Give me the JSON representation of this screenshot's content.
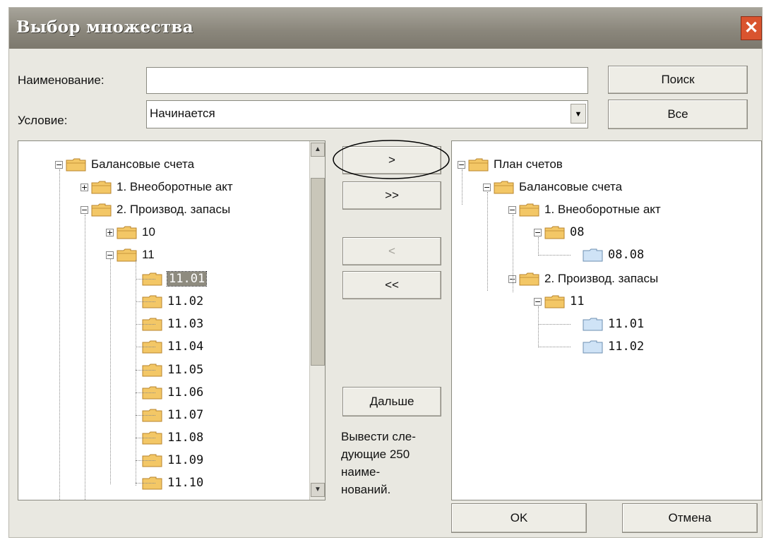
{
  "window": {
    "title": "Выбор множества",
    "close_glyph": "✕"
  },
  "form": {
    "name_label": "Наименование:",
    "name_value": "",
    "condition_label": "Условие:",
    "condition_value": "Начинается",
    "search_button": "Поиск",
    "all_button": "Все"
  },
  "transfer": {
    "add_one": ">",
    "add_all": ">>",
    "remove_one": "<",
    "remove_all": "<<",
    "next_button": "Дальше",
    "next_note": [
      "Вывести сле-",
      "дующие 250",
      "наиме-",
      "нований."
    ]
  },
  "left_tree": [
    {
      "label": "Балансовые счета",
      "pm": "−"
    },
    {
      "label": "1. Внеоборотные акт",
      "pm": "+"
    },
    {
      "label": "2. Производ. запасы",
      "pm": "−"
    },
    {
      "label": "10",
      "pm": "+"
    },
    {
      "label": "11",
      "pm": "−"
    },
    {
      "label": "11.01",
      "selected": true
    },
    {
      "label": "11.02"
    },
    {
      "label": "11.03"
    },
    {
      "label": "11.04"
    },
    {
      "label": "11.05"
    },
    {
      "label": "11.06"
    },
    {
      "label": "11.07"
    },
    {
      "label": "11.08"
    },
    {
      "label": "11.09"
    },
    {
      "label": "11.10"
    }
  ],
  "right_tree": [
    {
      "label": "План счетов",
      "pm": "−"
    },
    {
      "label": "Балансовые счета",
      "pm": "−"
    },
    {
      "label": "1. Внеоборотные акт",
      "pm": "−"
    },
    {
      "label": "08",
      "pm": "−"
    },
    {
      "label": "08.08"
    },
    {
      "label": "2. Производ. запасы",
      "pm": "−"
    },
    {
      "label": "11",
      "pm": "−"
    },
    {
      "label": "11.01"
    },
    {
      "label": "11.02"
    }
  ],
  "footer": {
    "ok_button": "OK",
    "cancel_button": "Отмена"
  },
  "colors": {
    "folder_yellow": "#f3c766",
    "folder_blue": "#cfe3f6",
    "title_bar": "#8b877c",
    "selection": "#8e8b7f"
  }
}
